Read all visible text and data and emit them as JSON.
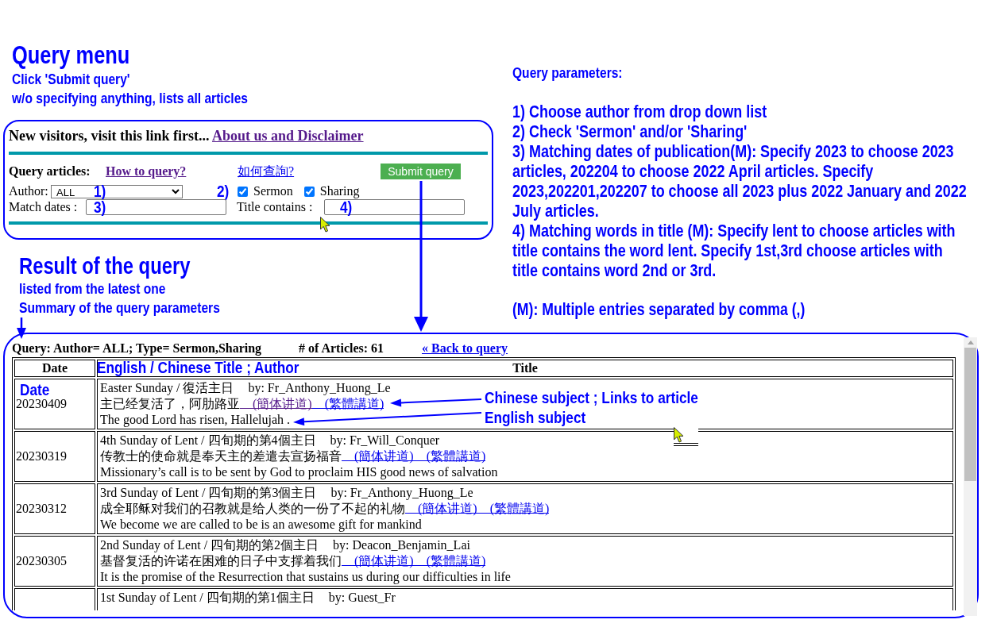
{
  "query_menu_note": {
    "title": "Query menu",
    "lines": [
      "Click 'Submit query'",
      "w/o specifying anything, lists all articles"
    ]
  },
  "parameters_note": {
    "heading": "Query parameters:",
    "items": [
      "1) Choose author from drop down list",
      "2) Check 'Sermon' and/or 'Sharing'",
      "3) Matching dates of publication(M): Specify 2023 to choose 2023 articles, 202204 to choose 2022 April articles. Specify 2023,202201,202207 to choose all 2023 plus 2022 January and 2022 July articles.",
      "4) Matching words in title (M): Specify lent to choose articles with title contains the word lent. Specify 1st,3rd choose articles with title contains word 2nd or 3rd."
    ],
    "footnote": "(M): Multiple entries separated by comma (,)"
  },
  "query_form": {
    "notice": "New visitors, visit this link first...",
    "notice_link": {
      "text": "About us and Disclaimer",
      "visited": true
    },
    "label": "Query articles:",
    "help_links": [
      {
        "text": "How to query?",
        "kind": "bold",
        "visited": true
      },
      {
        "text": "如何查詢?",
        "kind": "plain",
        "visited": false
      }
    ],
    "submit_button": "Submit query",
    "author": {
      "label": "Author:",
      "value": "ALL",
      "callout": "1)"
    },
    "types": {
      "callout": "2)",
      "options": [
        {
          "label": "Sermon",
          "checked": true
        },
        {
          "label": "Sharing",
          "checked": true
        }
      ]
    },
    "match_dates": {
      "label": "Match dates :",
      "callout": "3)"
    },
    "title_contains": {
      "label": "Title contains :",
      "callout": "4)"
    }
  },
  "result_note": {
    "title": "Result of the query",
    "lines": [
      "listed from the latest one",
      "Summary of the query parameters"
    ]
  },
  "results": {
    "summary": "Query: Author= ALL; Type= Sermon,Sharing",
    "article_count": "# of Articles: 61",
    "back_link": {
      "text": "« Back to query",
      "visited": false
    },
    "columns": [
      {
        "label": "Date"
      },
      {
        "label": "Title",
        "callout": "English / Chinese Title ; Author"
      }
    ],
    "rows": [
      {
        "date": "20230409",
        "date_callout": "Date",
        "title": "Easter Sunday / 復活主日",
        "author": "by: Fr_Anthony_Huong_Le",
        "subject_zh": "主已经复活了，阿肋路亚",
        "links": [
          {
            "text": "(簡体讲道)",
            "visited": true
          },
          {
            "text": "(繁體講道)",
            "visited": false
          }
        ],
        "subject_en": "The good Lord has risen, Hallelujah .",
        "callouts": [
          "Chinese subject ; Links to article",
          "English subject"
        ]
      },
      {
        "date": "20230319",
        "title": "4th Sunday of Lent / 四旬期的第4個主日",
        "author": "by: Fr_Will_Conquer",
        "subject_zh": "传教士的使命就是奉天主的差遣去宣扬福音",
        "links": [
          {
            "text": "(簡体讲道)",
            "visited": false
          },
          {
            "text": "(繁體講道)",
            "visited": false
          }
        ],
        "subject_en": "Missionary’s call is to be sent by God to proclaim HIS good news of salvation"
      },
      {
        "date": "20230312",
        "title": "3rd Sunday of Lent / 四旬期的第3個主日",
        "author": "by: Fr_Anthony_Huong_Le",
        "subject_zh": "成全耶稣对我们的召教就是给人类的一份了不起的礼物",
        "links": [
          {
            "text": "(簡体讲道)",
            "visited": false
          },
          {
            "text": "(繁體講道)",
            "visited": false
          }
        ],
        "subject_en": "We become we are called to be is an awesome gift for mankind"
      },
      {
        "date": "20230305",
        "title": "2nd Sunday of Lent / 四旬期的第2個主日",
        "author": "by: Deacon_Benjamin_Lai",
        "subject_zh": "基督复活的许诺在困难的日子中支撑着我们",
        "links": [
          {
            "text": "(簡体讲道)",
            "visited": false
          },
          {
            "text": "(繁體講道)",
            "visited": false
          }
        ],
        "subject_en": "It is the promise of the Resurrection that sustains us during our difficulties in life"
      },
      {
        "title": "1st Sunday of Lent / 四旬期的第1個主日",
        "author": "by: Guest_Fr"
      }
    ]
  }
}
